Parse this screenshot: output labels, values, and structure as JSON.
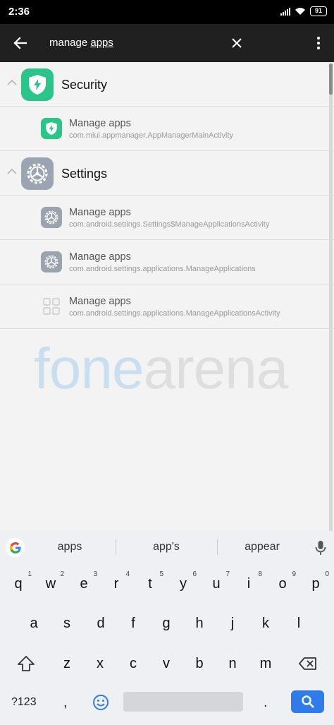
{
  "status_bar": {
    "time": "2:36",
    "battery": "91"
  },
  "search": {
    "query_prefix": "manage ",
    "query_suffix": "apps"
  },
  "groups": [
    {
      "title": "Security",
      "entries": [
        {
          "title": "Manage apps",
          "activity": "com.miui.appmanager.AppManagerMainActivity"
        }
      ]
    },
    {
      "title": "Settings",
      "entries": [
        {
          "title": "Manage apps",
          "activity": "com.android.settings.Settings$ManageApplicationsActivity"
        },
        {
          "title": "Manage apps",
          "activity": "com.android.settings.applications.ManageApplications"
        },
        {
          "title": "Manage apps",
          "activity": "com.android.settings.applications.ManageApplicationsActivity"
        }
      ]
    }
  ],
  "watermark": {
    "part1": "fone",
    "part2": "arena"
  },
  "keyboard": {
    "suggestions": [
      "apps",
      "app's",
      "appear"
    ],
    "row1": [
      "q",
      "w",
      "e",
      "r",
      "t",
      "y",
      "u",
      "i",
      "o",
      "p"
    ],
    "row1_hints": [
      "1",
      "2",
      "3",
      "4",
      "5",
      "6",
      "7",
      "8",
      "9",
      "0"
    ],
    "row2": [
      "a",
      "s",
      "d",
      "f",
      "g",
      "h",
      "j",
      "k",
      "l"
    ],
    "row3": [
      "z",
      "x",
      "c",
      "v",
      "b",
      "n",
      "m"
    ],
    "symbols_label": "?123",
    "comma": ",",
    "period": "."
  },
  "colors": {
    "security_green": "#2ac58a",
    "settings_gray": "#9aa5b1",
    "search_key_blue": "#2f7bea",
    "app_bar": "#202020"
  }
}
